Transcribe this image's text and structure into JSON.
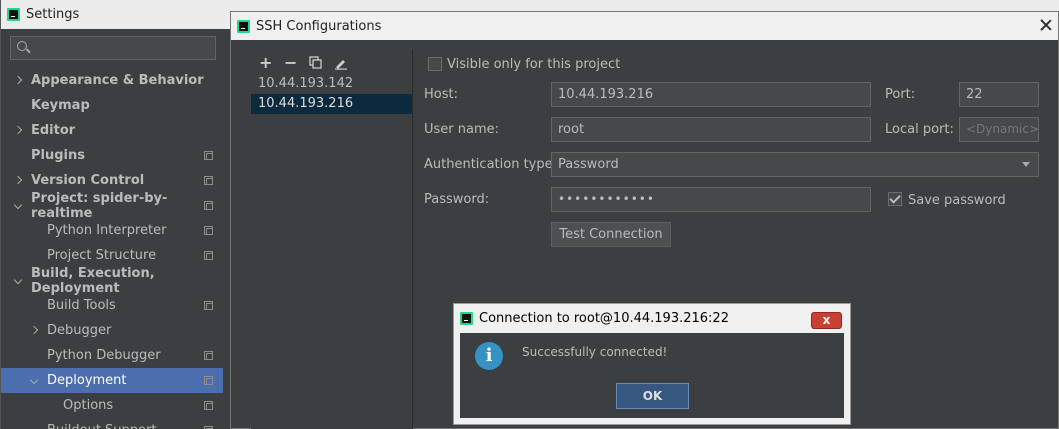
{
  "settings": {
    "title": "Settings",
    "search": {
      "placeholder": ""
    },
    "tree": [
      {
        "label": "Appearance & Behavior",
        "level": 0,
        "expander": "right",
        "bold": true,
        "copy": false,
        "selected": false
      },
      {
        "label": "Keymap",
        "level": 0,
        "expander": "",
        "bold": true,
        "copy": false,
        "selected": false
      },
      {
        "label": "Editor",
        "level": 0,
        "expander": "right",
        "bold": true,
        "copy": false,
        "selected": false
      },
      {
        "label": "Plugins",
        "level": 0,
        "expander": "",
        "bold": true,
        "copy": true,
        "selected": false
      },
      {
        "label": "Version Control",
        "level": 0,
        "expander": "right",
        "bold": true,
        "copy": true,
        "selected": false
      },
      {
        "label": "Project: spider-by-realtime",
        "level": 0,
        "expander": "down",
        "bold": true,
        "copy": true,
        "selected": false
      },
      {
        "label": "Python Interpreter",
        "level": 1,
        "expander": "",
        "bold": false,
        "copy": true,
        "selected": false
      },
      {
        "label": "Project Structure",
        "level": 1,
        "expander": "",
        "bold": false,
        "copy": true,
        "selected": false
      },
      {
        "label": "Build, Execution, Deployment",
        "level": 0,
        "expander": "down",
        "bold": true,
        "copy": false,
        "selected": false
      },
      {
        "label": "Build Tools",
        "level": 1,
        "expander": "",
        "bold": false,
        "copy": true,
        "selected": false
      },
      {
        "label": "Debugger",
        "level": 1,
        "expander": "right",
        "bold": false,
        "copy": false,
        "selected": false
      },
      {
        "label": "Python Debugger",
        "level": 1,
        "expander": "",
        "bold": false,
        "copy": true,
        "selected": false
      },
      {
        "label": "Deployment",
        "level": 1,
        "expander": "down",
        "bold": false,
        "copy": true,
        "selected": true
      },
      {
        "label": "Options",
        "level": 2,
        "expander": "",
        "bold": false,
        "copy": true,
        "selected": false
      },
      {
        "label": "Buildout Support",
        "level": 1,
        "expander": "",
        "bold": false,
        "copy": true,
        "selected": false
      }
    ]
  },
  "ssh": {
    "title": "SSH Configurations",
    "toolbar": {
      "add": "+",
      "remove": "−"
    },
    "hosts": [
      {
        "label": "10.44.193.142",
        "selected": false
      },
      {
        "label": "10.44.193.216",
        "selected": true
      }
    ],
    "visible_only_label": "Visible only for this project",
    "visible_only_checked": false,
    "host_label": "Host:",
    "host_value": "10.44.193.216",
    "port_label": "Port:",
    "port_value": "22",
    "username_label": "User name:",
    "username_value": "root",
    "local_port_label": "Local port:",
    "local_port_placeholder": "<Dynamic>",
    "auth_label": "Authentication type:",
    "auth_value": "Password",
    "password_label": "Password:",
    "password_value": "••••••••••••",
    "save_password_label": "Save password",
    "save_password_checked": true,
    "test_button": "Test Connection"
  },
  "dialog": {
    "title": "Connection to root@10.44.193.216:22",
    "close": "x",
    "message": "Successfully connected!",
    "info_glyph": "i",
    "ok": "OK"
  },
  "colors": {
    "background": "#3c3f41",
    "selection": "#4b6eaf",
    "ok_button": "#365880",
    "close_button": "#c84031"
  }
}
